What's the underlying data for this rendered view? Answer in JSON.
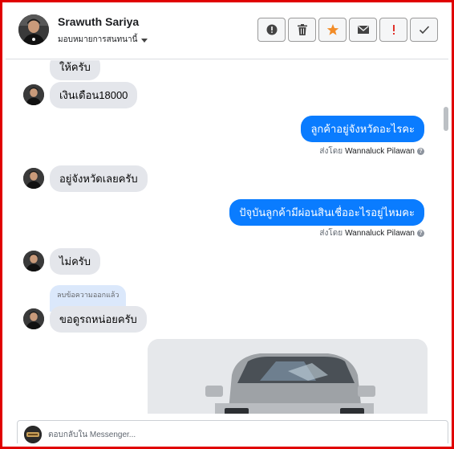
{
  "header": {
    "contact_name": "Srawuth Sariya",
    "assign_label": "มอบหมายการสนทนานี้",
    "actions": [
      {
        "name": "alert-circle-icon"
      },
      {
        "name": "trash-icon"
      },
      {
        "name": "star-icon",
        "color": "#f28c28"
      },
      {
        "name": "envelope-icon"
      },
      {
        "name": "exclamation-icon",
        "color": "#e0322b"
      },
      {
        "name": "check-icon"
      }
    ]
  },
  "messages": {
    "m0": "ให้ครับ",
    "m1": "เงินเดือน18000",
    "m2": "ลูกค้าอยู่จังหวัดอะไรคะ",
    "m2_sent_prefix": "ส่งโดย",
    "m2_sent_name": "Wannaluck Pilawan",
    "m3": "อยู่จังหวัดเลยครับ",
    "m4": "ปัจุบันลูกค้ามีผ่อนสินเชื่ออะไรอยู่ไหมคะ",
    "m4_sent_prefix": "ส่งโดย",
    "m4_sent_name": "Wannaluck Pilawan",
    "m5": "ไม่ครับ",
    "deleted_notice": "ลบข้อความออกแล้ว",
    "m6": "ขอดูรถหน่อยครับ"
  },
  "composer": {
    "placeholder": "ตอบกลับใน Messenger..."
  },
  "colors": {
    "accent": "#0a7cff",
    "incoming_bubble": "#e4e6eb",
    "frame": "#e00000"
  }
}
